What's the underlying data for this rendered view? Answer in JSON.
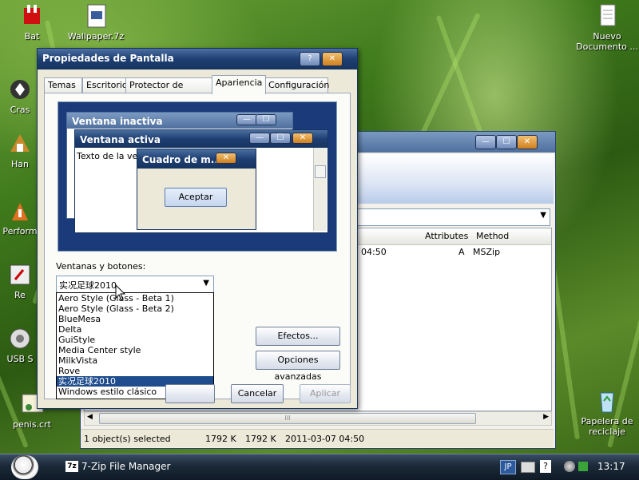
{
  "desktop_icons": [
    {
      "label": "Bat",
      "icon": "bat-file-icon"
    },
    {
      "label": "Wallpaper.7z",
      "icon": "archive-icon"
    },
    {
      "label": "Nuevo Documento ...",
      "icon": "text-document-icon"
    },
    {
      "label": "Cras",
      "icon": "crash-icon"
    },
    {
      "label": "Han",
      "icon": "program-icon"
    },
    {
      "label": "Perform",
      "icon": "performance-icon"
    },
    {
      "label": "Re",
      "icon": "shortcut-icon"
    },
    {
      "label": "USB S",
      "icon": "usb-icon"
    },
    {
      "label": "penis.crt",
      "icon": "certificate-icon"
    },
    {
      "label": "Papelera de reciclaje",
      "icon": "recycle-bin-icon"
    }
  ],
  "zip_window": {
    "columns": [
      "Attributes",
      "Method"
    ],
    "row": {
      "time": "04:50",
      "attributes": "A",
      "method": "MSZip"
    },
    "scroll_mark": "III",
    "status": {
      "selected": "1 object(s) selected",
      "size": "1792 K",
      "packed": "1792 K",
      "modified": "2011-03-07 04:50"
    }
  },
  "dialog": {
    "title": "Propiedades de Pantalla",
    "help_glyph": "?",
    "close_glyph": "✕",
    "tabs": [
      "Temas",
      "Escritorio",
      "Protector de pantalla",
      "Apariencia",
      "Configuración"
    ],
    "selected_tab": "Apariencia",
    "preview": {
      "inactive_title": "Ventana inactiva",
      "active_title": "Ventana activa",
      "window_text": "Texto de la vent",
      "msgbox_title": "Cuadro de m...",
      "msgbox_button": "Aceptar"
    },
    "styles_label": "Ventanas y botones:",
    "styles_value": "实况足球2010",
    "styles_options": [
      "Aero Style (Glass - Beta 1)",
      "Aero Style (Glass - Beta 2)",
      "BlueMesa",
      "Delta",
      "GuiStyle",
      "Media Center style",
      "MilkVista",
      "Rove",
      "实况足球2010",
      "Windows estilo clásico"
    ],
    "selected_option": "实况足球2010",
    "buttons": {
      "effects": "Efectos...",
      "advanced": "Opciones avanzadas",
      "cancel": "Cancelar",
      "apply": "Aplicar"
    }
  },
  "taskbar": {
    "task_label": "7-Zip File Manager",
    "task_icon_text": "7z",
    "language": "JP",
    "help_glyph": "?",
    "time": "13:17"
  }
}
